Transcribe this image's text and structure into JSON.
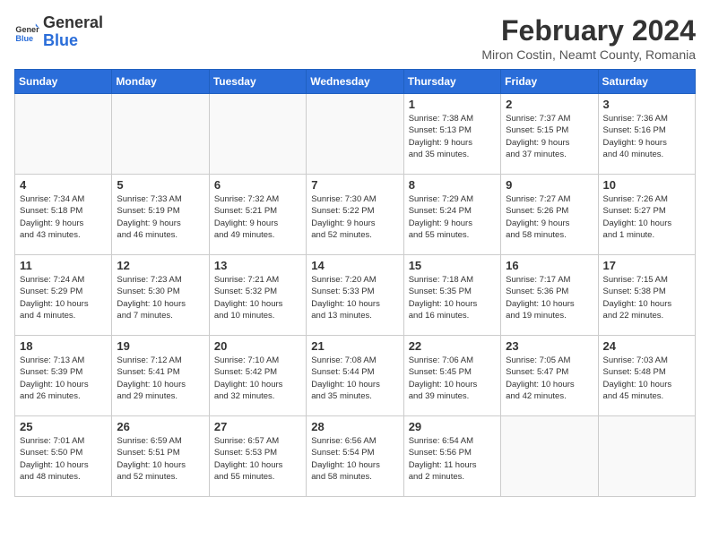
{
  "header": {
    "logo_general": "General",
    "logo_blue": "Blue",
    "month_title": "February 2024",
    "subtitle": "Miron Costin, Neamt County, Romania"
  },
  "days_of_week": [
    "Sunday",
    "Monday",
    "Tuesday",
    "Wednesday",
    "Thursday",
    "Friday",
    "Saturday"
  ],
  "weeks": [
    [
      {
        "day": "",
        "detail": ""
      },
      {
        "day": "",
        "detail": ""
      },
      {
        "day": "",
        "detail": ""
      },
      {
        "day": "",
        "detail": ""
      },
      {
        "day": "1",
        "detail": "Sunrise: 7:38 AM\nSunset: 5:13 PM\nDaylight: 9 hours\nand 35 minutes."
      },
      {
        "day": "2",
        "detail": "Sunrise: 7:37 AM\nSunset: 5:15 PM\nDaylight: 9 hours\nand 37 minutes."
      },
      {
        "day": "3",
        "detail": "Sunrise: 7:36 AM\nSunset: 5:16 PM\nDaylight: 9 hours\nand 40 minutes."
      }
    ],
    [
      {
        "day": "4",
        "detail": "Sunrise: 7:34 AM\nSunset: 5:18 PM\nDaylight: 9 hours\nand 43 minutes."
      },
      {
        "day": "5",
        "detail": "Sunrise: 7:33 AM\nSunset: 5:19 PM\nDaylight: 9 hours\nand 46 minutes."
      },
      {
        "day": "6",
        "detail": "Sunrise: 7:32 AM\nSunset: 5:21 PM\nDaylight: 9 hours\nand 49 minutes."
      },
      {
        "day": "7",
        "detail": "Sunrise: 7:30 AM\nSunset: 5:22 PM\nDaylight: 9 hours\nand 52 minutes."
      },
      {
        "day": "8",
        "detail": "Sunrise: 7:29 AM\nSunset: 5:24 PM\nDaylight: 9 hours\nand 55 minutes."
      },
      {
        "day": "9",
        "detail": "Sunrise: 7:27 AM\nSunset: 5:26 PM\nDaylight: 9 hours\nand 58 minutes."
      },
      {
        "day": "10",
        "detail": "Sunrise: 7:26 AM\nSunset: 5:27 PM\nDaylight: 10 hours\nand 1 minute."
      }
    ],
    [
      {
        "day": "11",
        "detail": "Sunrise: 7:24 AM\nSunset: 5:29 PM\nDaylight: 10 hours\nand 4 minutes."
      },
      {
        "day": "12",
        "detail": "Sunrise: 7:23 AM\nSunset: 5:30 PM\nDaylight: 10 hours\nand 7 minutes."
      },
      {
        "day": "13",
        "detail": "Sunrise: 7:21 AM\nSunset: 5:32 PM\nDaylight: 10 hours\nand 10 minutes."
      },
      {
        "day": "14",
        "detail": "Sunrise: 7:20 AM\nSunset: 5:33 PM\nDaylight: 10 hours\nand 13 minutes."
      },
      {
        "day": "15",
        "detail": "Sunrise: 7:18 AM\nSunset: 5:35 PM\nDaylight: 10 hours\nand 16 minutes."
      },
      {
        "day": "16",
        "detail": "Sunrise: 7:17 AM\nSunset: 5:36 PM\nDaylight: 10 hours\nand 19 minutes."
      },
      {
        "day": "17",
        "detail": "Sunrise: 7:15 AM\nSunset: 5:38 PM\nDaylight: 10 hours\nand 22 minutes."
      }
    ],
    [
      {
        "day": "18",
        "detail": "Sunrise: 7:13 AM\nSunset: 5:39 PM\nDaylight: 10 hours\nand 26 minutes."
      },
      {
        "day": "19",
        "detail": "Sunrise: 7:12 AM\nSunset: 5:41 PM\nDaylight: 10 hours\nand 29 minutes."
      },
      {
        "day": "20",
        "detail": "Sunrise: 7:10 AM\nSunset: 5:42 PM\nDaylight: 10 hours\nand 32 minutes."
      },
      {
        "day": "21",
        "detail": "Sunrise: 7:08 AM\nSunset: 5:44 PM\nDaylight: 10 hours\nand 35 minutes."
      },
      {
        "day": "22",
        "detail": "Sunrise: 7:06 AM\nSunset: 5:45 PM\nDaylight: 10 hours\nand 39 minutes."
      },
      {
        "day": "23",
        "detail": "Sunrise: 7:05 AM\nSunset: 5:47 PM\nDaylight: 10 hours\nand 42 minutes."
      },
      {
        "day": "24",
        "detail": "Sunrise: 7:03 AM\nSunset: 5:48 PM\nDaylight: 10 hours\nand 45 minutes."
      }
    ],
    [
      {
        "day": "25",
        "detail": "Sunrise: 7:01 AM\nSunset: 5:50 PM\nDaylight: 10 hours\nand 48 minutes."
      },
      {
        "day": "26",
        "detail": "Sunrise: 6:59 AM\nSunset: 5:51 PM\nDaylight: 10 hours\nand 52 minutes."
      },
      {
        "day": "27",
        "detail": "Sunrise: 6:57 AM\nSunset: 5:53 PM\nDaylight: 10 hours\nand 55 minutes."
      },
      {
        "day": "28",
        "detail": "Sunrise: 6:56 AM\nSunset: 5:54 PM\nDaylight: 10 hours\nand 58 minutes."
      },
      {
        "day": "29",
        "detail": "Sunrise: 6:54 AM\nSunset: 5:56 PM\nDaylight: 11 hours\nand 2 minutes."
      },
      {
        "day": "",
        "detail": ""
      },
      {
        "day": "",
        "detail": ""
      }
    ]
  ]
}
